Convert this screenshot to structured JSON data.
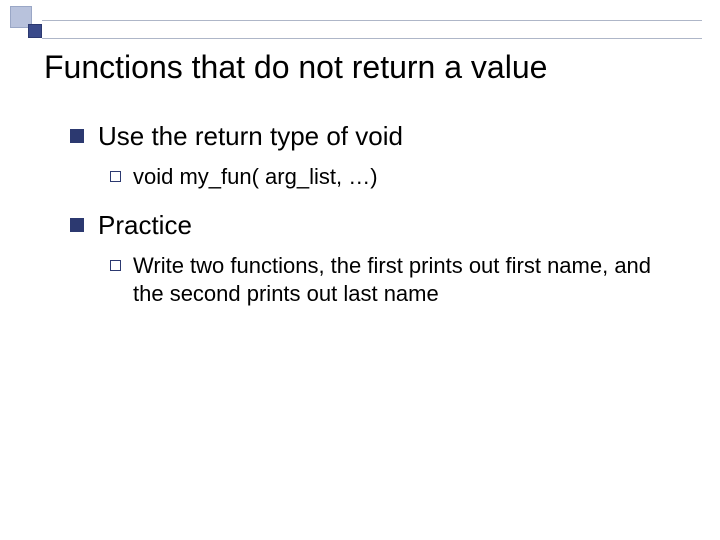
{
  "title": "Functions that do not return a value",
  "items": [
    {
      "label": "Use the return type of void",
      "children": [
        {
          "label": "void my_fun( arg_list, …)"
        }
      ]
    },
    {
      "label": "Practice",
      "children": [
        {
          "label": "Write two functions, the first prints out first name, and the second prints out last name"
        }
      ]
    }
  ]
}
